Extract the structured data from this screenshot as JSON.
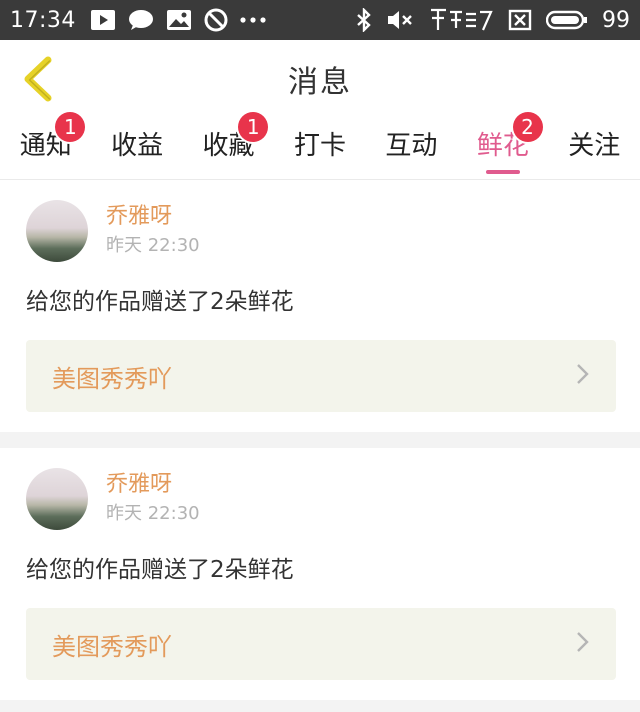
{
  "status": {
    "time": "17:34",
    "battery": "99",
    "app_icons": [
      "play-icon",
      "chat-icon",
      "image-icon",
      "block-icon",
      "more-icon"
    ],
    "right_icons": [
      "bluetooth-icon",
      "mute-icon",
      "hatsune-logo",
      "close-box-icon",
      "battery-icon"
    ]
  },
  "header": {
    "title": "消息",
    "back_icon": "chevron-left-icon"
  },
  "tabs": [
    {
      "label": "通知",
      "badge": "1",
      "active": false
    },
    {
      "label": "收益",
      "badge": "",
      "active": false
    },
    {
      "label": "收藏",
      "badge": "1",
      "active": false
    },
    {
      "label": "打卡",
      "badge": "",
      "active": false
    },
    {
      "label": "互动",
      "badge": "",
      "active": false
    },
    {
      "label": "鲜花",
      "badge": "2",
      "active": true
    },
    {
      "label": "关注",
      "badge": "",
      "active": false
    }
  ],
  "messages": [
    {
      "sender": "乔雅呀",
      "time": "昨天 22:30",
      "text": "给您的作品赠送了2朵鲜花",
      "work_title": "美图秀秀吖"
    },
    {
      "sender": "乔雅呀",
      "time": "昨天 22:30",
      "text": "给您的作品赠送了2朵鲜花",
      "work_title": "美图秀秀吖"
    }
  ],
  "colors": {
    "accent": "#e05b8e",
    "badge": "#e8344b",
    "sender": "#e39a5b",
    "back_icon": "#e6d227"
  }
}
